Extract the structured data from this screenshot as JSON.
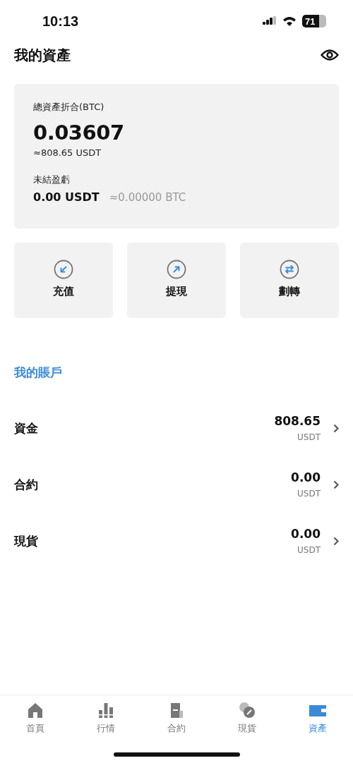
{
  "status_bar": {
    "time": "10:13",
    "battery": "71"
  },
  "header": {
    "title": "我的資產"
  },
  "summary": {
    "label": "總資產折合(BTC)",
    "value": "0.03607",
    "approx": "≈808.65 USDT",
    "pnl_label": "未結盈虧",
    "pnl_value": "0.00 USDT",
    "pnl_approx": "≈0.00000 BTC"
  },
  "actions": [
    {
      "kind": "deposit",
      "label": "充值"
    },
    {
      "kind": "withdraw",
      "label": "提現"
    },
    {
      "kind": "transfer",
      "label": "劃轉"
    }
  ],
  "accounts": {
    "title": "我的賬戶",
    "items": [
      {
        "name": "資金",
        "amount": "808.65",
        "unit": "USDT"
      },
      {
        "name": "合約",
        "amount": "0.00",
        "unit": "USDT"
      },
      {
        "name": "現貨",
        "amount": "0.00",
        "unit": "USDT"
      }
    ]
  },
  "tab_bar": [
    {
      "kind": "home",
      "label": "首頁",
      "selected": false
    },
    {
      "kind": "market",
      "label": "行情",
      "selected": false
    },
    {
      "kind": "futures",
      "label": "合約",
      "selected": false
    },
    {
      "kind": "spot",
      "label": "現貨",
      "selected": false
    },
    {
      "kind": "assets",
      "label": "資產",
      "selected": true
    }
  ]
}
